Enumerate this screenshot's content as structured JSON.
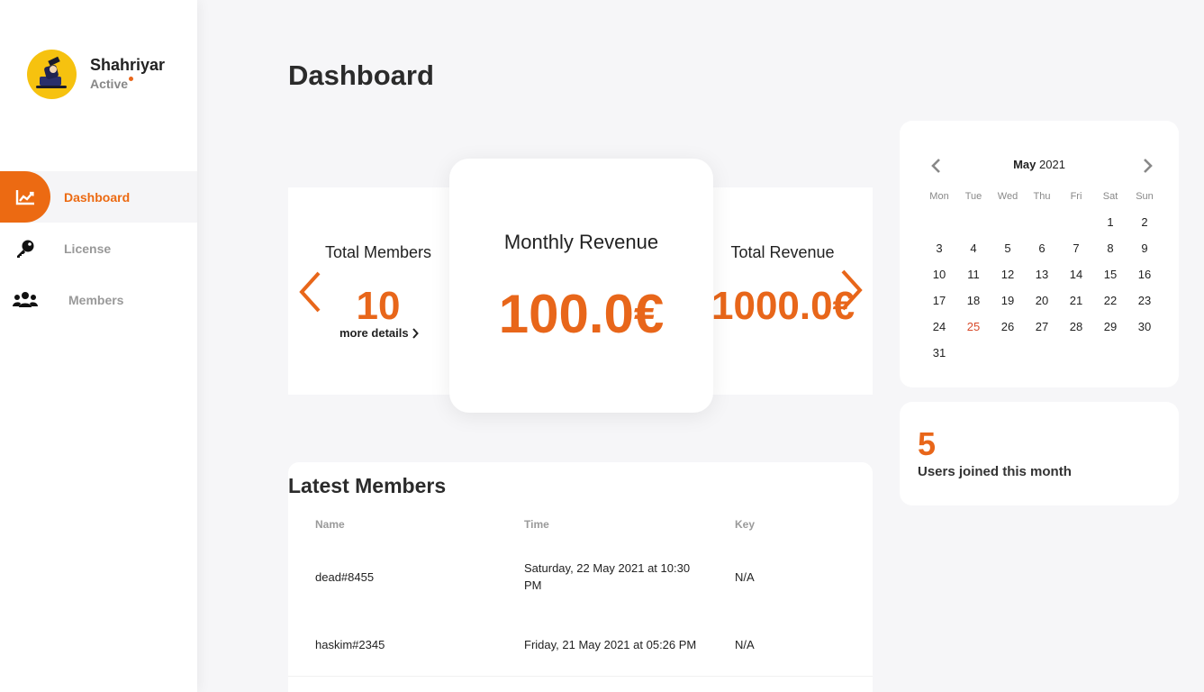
{
  "user": {
    "name": "Shahriyar",
    "status": "Active"
  },
  "nav": [
    {
      "label": "Dashboard",
      "icon": "chart-line-icon",
      "active": true
    },
    {
      "label": "License",
      "icon": "key-icon",
      "active": false
    },
    {
      "label": "Members",
      "icon": "users-icon",
      "active": false
    }
  ],
  "page": {
    "title": "Dashboard"
  },
  "stats": {
    "total_members_label": "Total Members",
    "total_members_value": "10",
    "more_details": "more details",
    "monthly_revenue_label": "Monthly Revenue",
    "monthly_revenue_value": "100.0€",
    "total_revenue_label": "Total Revenue",
    "total_revenue_value": "1000.0€"
  },
  "calendar": {
    "month": "May",
    "year": "2021",
    "weekdays": [
      "Mon",
      "Tue",
      "Wed",
      "Thu",
      "Fri",
      "Sat",
      "Sun"
    ],
    "first_weekday_index": 5,
    "days_in_month": 31,
    "highlighted_day": 25
  },
  "joined": {
    "value": "5",
    "label": "Users joined this month"
  },
  "latest_members": {
    "title": "Latest Members",
    "columns": [
      "Name",
      "Time",
      "Key"
    ],
    "rows": [
      {
        "name": "dead#8455",
        "time": "Saturday, 22 May 2021 at 10:30 PM",
        "key": "N/A"
      },
      {
        "name": "haskim#2345",
        "time": "Friday, 21 May 2021 at 05:26 PM",
        "key": "N/A"
      }
    ]
  },
  "colors": {
    "accent": "#ec6a12",
    "value": "#e8661a",
    "today": "#d84a2a"
  }
}
